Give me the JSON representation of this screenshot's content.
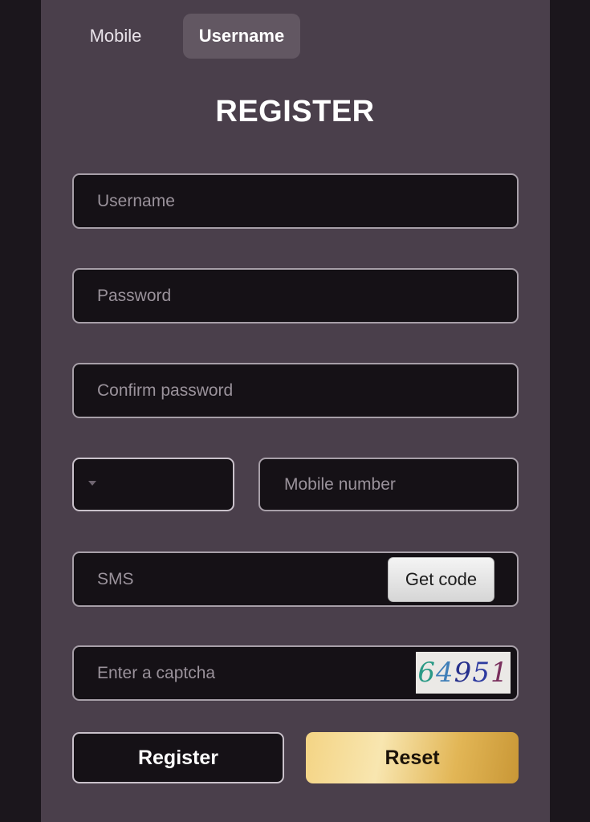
{
  "tabs": {
    "mobile": "Mobile",
    "username": "Username",
    "active": "Username"
  },
  "title": "REGISTER",
  "fields": {
    "username": {
      "placeholder": "Username",
      "value": ""
    },
    "password": {
      "placeholder": "Password",
      "value": ""
    },
    "confirm_password": {
      "placeholder": "Confirm password",
      "value": ""
    },
    "country_code": {
      "value": ""
    },
    "mobile_number": {
      "placeholder": "Mobile number",
      "value": ""
    },
    "sms": {
      "placeholder": "SMS",
      "value": ""
    },
    "captcha": {
      "placeholder": "Enter a captcha",
      "value": ""
    }
  },
  "get_code_label": "Get code",
  "captcha_image_text": "64951",
  "captcha_digit_colors": [
    "#2a9a86",
    "#3f7fb8",
    "#26308c",
    "#2e3ba0",
    "#7a2f5d"
  ],
  "buttons": {
    "register": "Register",
    "reset": "Reset"
  },
  "colors": {
    "panel": "#4a3f4b",
    "field_bg": "#151116",
    "accent_gold": "#e2b656"
  }
}
